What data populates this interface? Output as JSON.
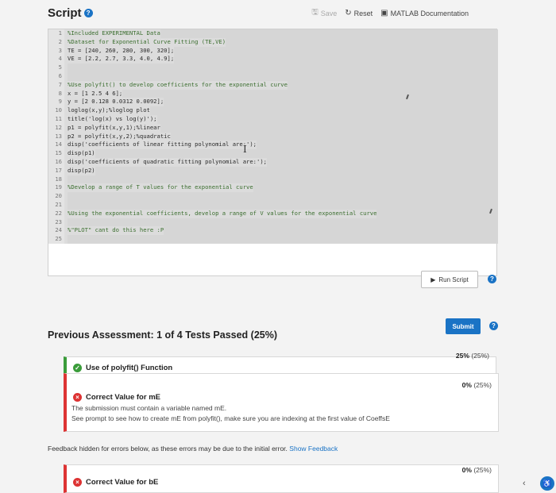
{
  "header": {
    "title": "Script",
    "help_glyph": "?",
    "save_label": "Save",
    "reset_label": "Reset",
    "docs_label": "MATLAB Documentation"
  },
  "editor": {
    "lines": [
      {
        "num": "1",
        "text": "%Included EXPERIMENTAL Data",
        "comment": true
      },
      {
        "num": "2",
        "text": "%Dataset for Exponential Curve Fitting (TE,VE)",
        "comment": true
      },
      {
        "num": "3",
        "text": "TE = [240, 260, 280, 300, 320];",
        "comment": false
      },
      {
        "num": "4",
        "text": "VE = [2.2, 2.7, 3.3, 4.0, 4.9];",
        "comment": false
      },
      {
        "num": "5",
        "text": "",
        "comment": false
      },
      {
        "num": "6",
        "text": "",
        "comment": false
      },
      {
        "num": "7",
        "text": "%Use polyfit() to develop coefficients for the exponential curve",
        "comment": true
      },
      {
        "num": "8",
        "text": "x = [1 2.5 4 6];",
        "comment": false
      },
      {
        "num": "9",
        "text": "y = [2 0.128 0.0312 0.0092];",
        "comment": false
      },
      {
        "num": "10",
        "text": "loglog(x,y);%loglog plot",
        "comment": false
      },
      {
        "num": "11",
        "text": "title('log(x) vs log(y)');",
        "comment": false
      },
      {
        "num": "12",
        "text": "p1 = polyfit(x,y,1);%linear",
        "comment": false
      },
      {
        "num": "13",
        "text": "p2 = polyfit(x,y,2);%quadratic",
        "comment": false
      },
      {
        "num": "14",
        "text": "disp('coefficients of linear fitting polynomial are:');",
        "comment": false
      },
      {
        "num": "15",
        "text": "disp(p1)",
        "comment": false
      },
      {
        "num": "16",
        "text": "disp('coefficients of quadratic fitting polynomial are:');",
        "comment": false
      },
      {
        "num": "17",
        "text": "disp(p2)",
        "comment": false
      },
      {
        "num": "18",
        "text": "",
        "comment": false
      },
      {
        "num": "19",
        "text": "%Develop a range of T values for the exponential curve",
        "comment": true
      },
      {
        "num": "20",
        "text": "",
        "comment": false
      },
      {
        "num": "21",
        "text": "",
        "comment": false
      },
      {
        "num": "22",
        "text": "%Using the exponential coefficients, develop a range of V values for the exponential curve",
        "comment": true
      },
      {
        "num": "23",
        "text": "",
        "comment": false
      },
      {
        "num": "24",
        "text": "%\"PLOT\" cant do this here :P",
        "comment": true
      },
      {
        "num": "25",
        "text": "",
        "comment": false
      }
    ]
  },
  "run_label": "Run Script",
  "submit_label": "Submit",
  "assessment": {
    "title": "Previous Assessment: 1 of 4 Tests Passed (25%)",
    "tests": [
      {
        "name": "Use of polyfit() Function",
        "score": "25%",
        "weight": "(25%)"
      },
      {
        "name": "Correct Value for mE",
        "score": "0%",
        "weight": "(25%)",
        "message_1": "The submission must contain a variable named mE.",
        "message_2": "See prompt to see how to create mE from polyfit(), make sure you are indexing at the first value of CoeffsE"
      },
      {
        "name": "Correct Value for bE",
        "score": "0%",
        "weight": "(25%)"
      }
    ],
    "feedback_text": "Feedback hidden for errors below, as these errors may be due to the initial error.",
    "feedback_link": "Show Feedback"
  },
  "colors": {
    "accent": "#1a73c5",
    "pass": "#3a9c3a",
    "fail": "#dd3333"
  }
}
